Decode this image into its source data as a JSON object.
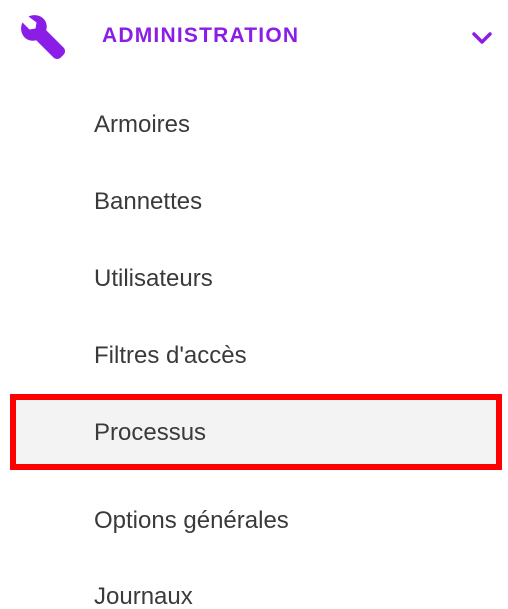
{
  "section": {
    "title": "ADMINISTRATION",
    "icon": "wrench-icon",
    "expand_icon": "chevron-down-icon",
    "accent_color": "#8a1ee6"
  },
  "items": [
    {
      "label": "Armoires"
    },
    {
      "label": "Bannettes"
    },
    {
      "label": "Utilisateurs"
    },
    {
      "label": "Filtres d'accès"
    },
    {
      "label": "Processus",
      "selected": true,
      "highlight_color": "#ff0000"
    },
    {
      "label": "Options générales"
    },
    {
      "label": "Journaux"
    }
  ]
}
